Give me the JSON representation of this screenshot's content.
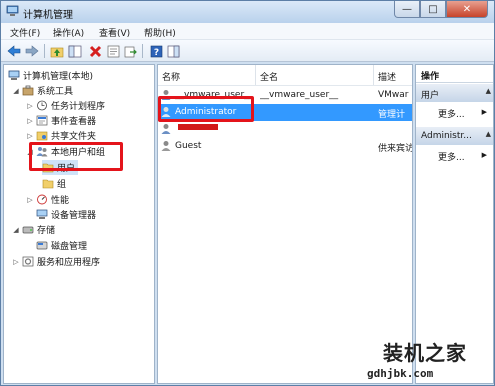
{
  "window": {
    "title": "计算机管理",
    "controls": {
      "minimize": "—",
      "maximize": "□",
      "close": "✕"
    }
  },
  "menubar": {
    "items": [
      {
        "label": "文件(F)"
      },
      {
        "label": "操作(A)"
      },
      {
        "label": "查看(V)"
      },
      {
        "label": "帮助(H)"
      }
    ]
  },
  "toolbar": {
    "icons": [
      "back-icon",
      "forward-icon",
      "up-folder-icon",
      "show-tree-icon",
      "delete-icon",
      "properties-icon",
      "export-icon",
      "help-icon",
      "show-action-pane-icon"
    ]
  },
  "tree": {
    "root": "计算机管理(本地)",
    "system_tools": "系统工具",
    "task_scheduler": "任务计划程序",
    "event_viewer": "事件查看器",
    "shared_folders": "共享文件夹",
    "local_users_groups": "本地用户和组",
    "users": "用户",
    "groups": "组",
    "performance": "性能",
    "device_manager": "设备管理器",
    "storage": "存储",
    "disk_management": "磁盘管理",
    "services_apps": "服务和应用程序"
  },
  "list": {
    "columns": [
      "名称",
      "全名",
      "描述"
    ],
    "rows": [
      {
        "name": "__vmware_user__",
        "full_name": "__vmware_user__",
        "description": "VMwar"
      },
      {
        "name": "Administrator",
        "full_name": "",
        "description": "管理计"
      },
      {
        "name": "",
        "full_name": "",
        "description": ""
      },
      {
        "name": "Guest",
        "full_name": "",
        "description": "供来宾访"
      }
    ]
  },
  "actions": {
    "title": "操作",
    "sections": [
      {
        "label": "用户",
        "more": "更多..."
      },
      {
        "label": "Administr...",
        "more": "更多..."
      }
    ]
  },
  "watermark": {
    "text": "装机之家",
    "url": "gdhjbk.com"
  },
  "colors": {
    "highlight_box": "#e4141b",
    "selection": "#3399ff",
    "window_frame": "#cfdff0"
  }
}
